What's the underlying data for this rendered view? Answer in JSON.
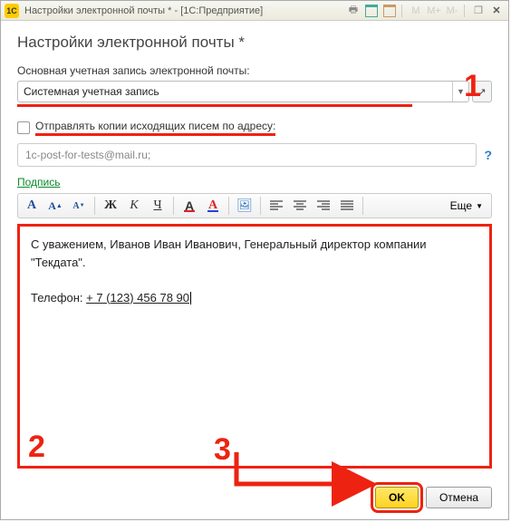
{
  "titlebar": {
    "logo_text": "1С",
    "title": "Настройки электронной почты * - [1С:Предприятие]",
    "buttons": {
      "print": "🖶",
      "cal1": "31",
      "cal2": "31",
      "m": "M",
      "mplus": "M+",
      "mminus": "M-",
      "restore": "❐",
      "close": "✕"
    }
  },
  "header": {
    "title": "Настройки электронной почты *"
  },
  "account": {
    "label": "Основная учетная запись электронной почты:",
    "value": "Системная учетная запись"
  },
  "cc": {
    "label": "Отправлять копии исходящих писем по адресу:",
    "email_value": "1c-post-for-tests@mail.ru;",
    "help": "?"
  },
  "signature": {
    "label": "Подпись",
    "text_line1": "С уважением, Иванов Иван Иванович, Генеральный директор компании \"Текдата\".",
    "phone_label": "Телефон: ",
    "phone_value": "+ 7 (123) 456 78 90"
  },
  "toolbar": {
    "font_a": "А",
    "bold": "Ж",
    "italic": "К",
    "underline": "Ч",
    "highlight": "A",
    "color": "А",
    "picture": "🖼",
    "align": "≡",
    "more": "Еще"
  },
  "footer": {
    "ok": "OK",
    "cancel": "Отмена"
  },
  "annotations": {
    "n1": "1",
    "n2": "2",
    "n3": "3"
  }
}
